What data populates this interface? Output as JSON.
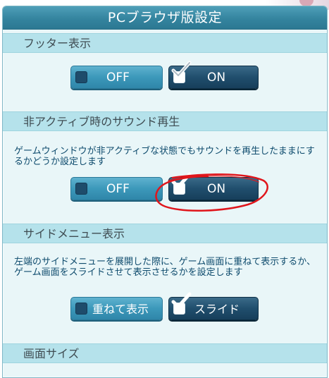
{
  "title": "PCブラウザ版設定",
  "sections": [
    {
      "header": "フッター表示",
      "options": [
        {
          "label": "OFF",
          "checked": false
        },
        {
          "label": "ON",
          "checked": true
        }
      ]
    },
    {
      "header": "非アクティブ時のサウンド再生",
      "description": "ゲームウィンドウが非アクティブな状態でもサウンドを再生したままにするかどうか設定します",
      "options": [
        {
          "label": "OFF",
          "checked": false
        },
        {
          "label": "ON",
          "checked": true
        }
      ]
    },
    {
      "header": "サイドメニュー表示",
      "description": "左端のサイドメニューを展開した際に、ゲーム画面に重ねて表示するか、ゲーム画面をスライドさせて表示させるかを設定します",
      "options": [
        {
          "label": "重ねて表示",
          "checked": false
        },
        {
          "label": "スライド",
          "checked": true
        }
      ]
    },
    {
      "header": "画面サイズ"
    }
  ],
  "colors": {
    "title_bar": "#3a8ba6",
    "section_header": "#b5e2eb",
    "panel_bg": "#e9f6f8",
    "off_button": "#3c98ba",
    "on_button": "#204e6d",
    "description_text": "#0e4b6d",
    "annotation_ring": "#e0161c"
  },
  "icons": {
    "unchecked": "empty-checkbox-icon",
    "checked": "checkmark-icon"
  }
}
